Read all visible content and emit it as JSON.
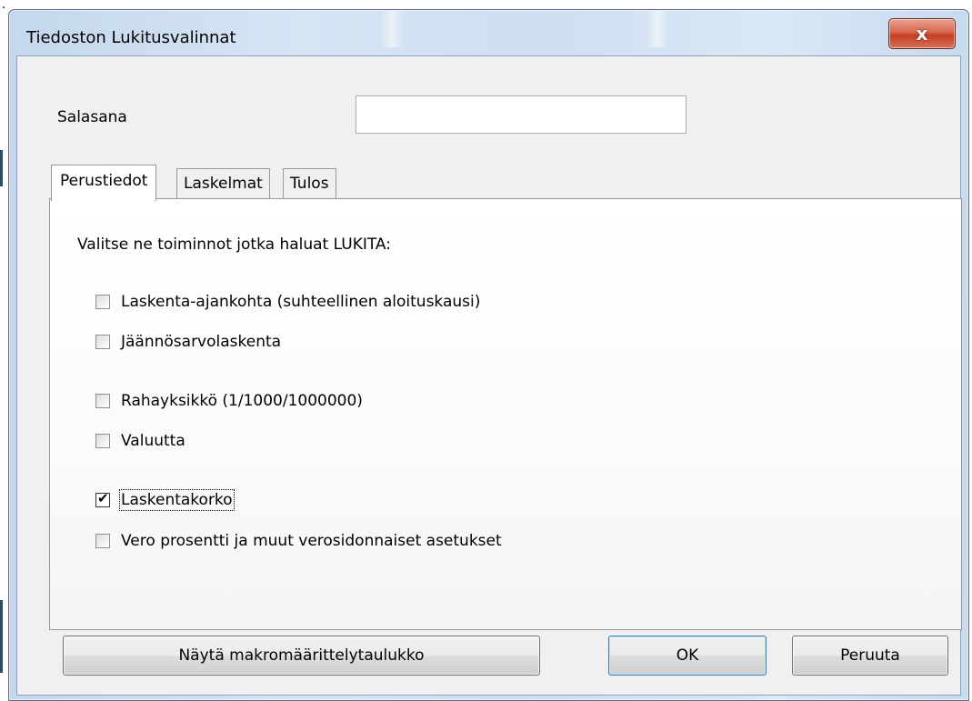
{
  "window": {
    "title": "Tiedoston Lukitusvalinnat",
    "close_glyph": "x"
  },
  "password": {
    "label": "Salasana",
    "value": "",
    "placeholder": ""
  },
  "tabs": [
    {
      "label": "Perustiedot",
      "active": true
    },
    {
      "label": "Laskelmat",
      "active": false
    },
    {
      "label": "Tulos",
      "active": false
    }
  ],
  "panel": {
    "instruction": "Valitse ne toiminnot jotka haluat LUKITA:",
    "options": [
      {
        "label": "Laskenta-ajankohta (suhteellinen aloituskausi)",
        "checked": false
      },
      {
        "label": "Jäännösarvolaskenta",
        "checked": false
      },
      {
        "label": "Rahayksikkö (1/1000/1000000)",
        "checked": false
      },
      {
        "label": "Valuutta",
        "checked": false
      },
      {
        "label": "Laskentakorko",
        "checked": true
      },
      {
        "label": "Vero prosentti ja muut verosidonnaiset asetukset",
        "checked": false
      }
    ]
  },
  "buttons": {
    "macro": "Näytä makromäärittelytaulukko",
    "ok": "OK",
    "cancel": "Peruuta"
  },
  "misc": {
    "top_left_mark": "."
  }
}
